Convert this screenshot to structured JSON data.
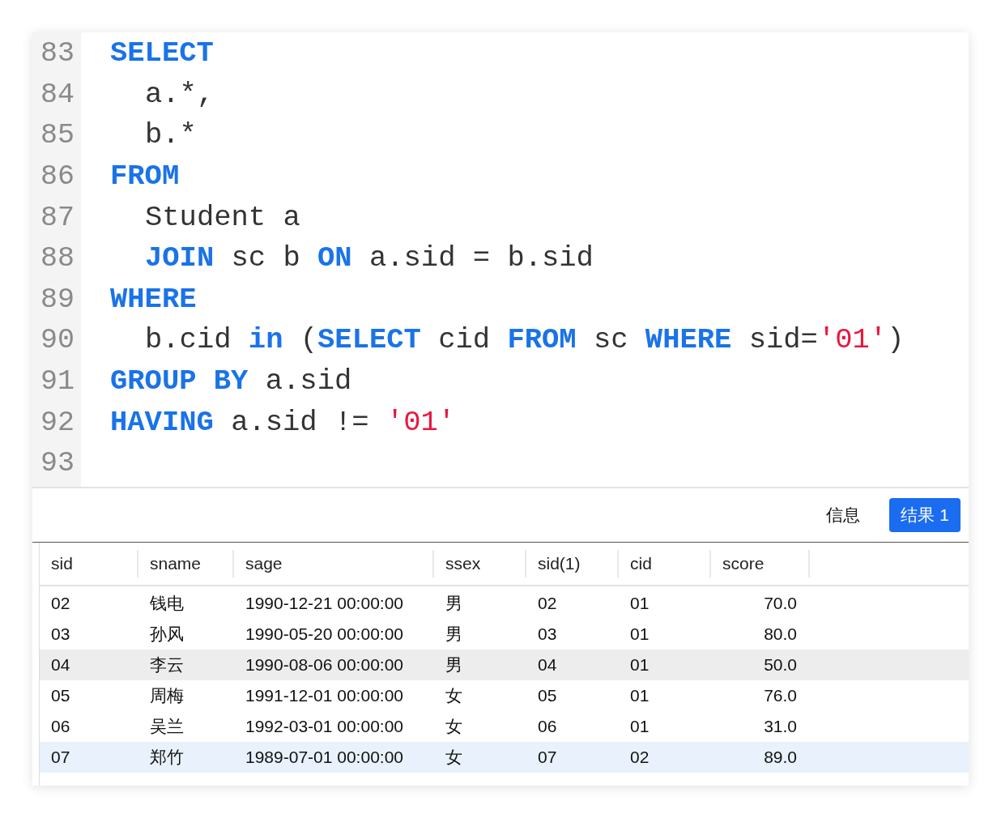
{
  "editor": {
    "lines": [
      {
        "number": "83",
        "indented": false,
        "tokens": [
          {
            "kind": "keyword",
            "text": "SELECT"
          }
        ]
      },
      {
        "number": "84",
        "indented": true,
        "tokens": [
          {
            "kind": "plain",
            "text": "a.*,"
          }
        ]
      },
      {
        "number": "85",
        "indented": true,
        "tokens": [
          {
            "kind": "plain",
            "text": "b.*"
          }
        ]
      },
      {
        "number": "86",
        "indented": false,
        "tokens": [
          {
            "kind": "keyword",
            "text": "FROM"
          }
        ]
      },
      {
        "number": "87",
        "indented": true,
        "tokens": [
          {
            "kind": "plain",
            "text": "Student a"
          }
        ]
      },
      {
        "number": "88",
        "indented": true,
        "tokens": [
          {
            "kind": "keyword",
            "text": "JOIN"
          },
          {
            "kind": "plain",
            "text": " sc b "
          },
          {
            "kind": "keyword",
            "text": "ON"
          },
          {
            "kind": "plain",
            "text": " a.sid = b.sid"
          }
        ]
      },
      {
        "number": "89",
        "indented": false,
        "tokens": [
          {
            "kind": "keyword",
            "text": "WHERE"
          }
        ]
      },
      {
        "number": "90",
        "indented": true,
        "tokens": [
          {
            "kind": "plain",
            "text": "b.cid "
          },
          {
            "kind": "keyword",
            "text": "in"
          },
          {
            "kind": "plain",
            "text": " ("
          },
          {
            "kind": "keyword",
            "text": "SELECT"
          },
          {
            "kind": "plain",
            "text": " cid "
          },
          {
            "kind": "keyword",
            "text": "FROM"
          },
          {
            "kind": "plain",
            "text": " sc "
          },
          {
            "kind": "keyword",
            "text": "WHERE"
          },
          {
            "kind": "plain",
            "text": " sid="
          },
          {
            "kind": "string",
            "text": "'01'"
          },
          {
            "kind": "plain",
            "text": ")"
          }
        ]
      },
      {
        "number": "91",
        "indented": false,
        "tokens": [
          {
            "kind": "keyword",
            "text": "GROUP BY"
          },
          {
            "kind": "plain",
            "text": " a.sid"
          }
        ]
      },
      {
        "number": "92",
        "indented": false,
        "tokens": [
          {
            "kind": "keyword",
            "text": "HAVING"
          },
          {
            "kind": "plain",
            "text": " a.sid != "
          },
          {
            "kind": "string",
            "text": "'01'"
          }
        ]
      },
      {
        "number": "93"
      }
    ]
  },
  "result_tabs": [
    {
      "label": "信息",
      "selected": false
    },
    {
      "label": "结果 1",
      "selected": true
    }
  ],
  "table": {
    "columns": [
      {
        "label": "sid"
      },
      {
        "label": "sname"
      },
      {
        "label": "sage"
      },
      {
        "label": "ssex"
      },
      {
        "label": "sid(1)"
      },
      {
        "label": "cid"
      },
      {
        "label": "score"
      }
    ],
    "rows": [
      {
        "selected": false,
        "hovered": false,
        "cells": [
          "02",
          "钱电",
          "1990-12-21 00:00:00",
          "男",
          "02",
          "01",
          "70.0"
        ]
      },
      {
        "selected": false,
        "hovered": false,
        "cells": [
          "03",
          "孙风",
          "1990-05-20 00:00:00",
          "男",
          "03",
          "01",
          "80.0"
        ]
      },
      {
        "selected": false,
        "hovered": true,
        "cells": [
          "04",
          "李云",
          "1990-08-06 00:00:00",
          "男",
          "04",
          "01",
          "50.0"
        ]
      },
      {
        "selected": false,
        "hovered": false,
        "cells": [
          "05",
          "周梅",
          "1991-12-01 00:00:00",
          "女",
          "05",
          "01",
          "76.0"
        ]
      },
      {
        "selected": false,
        "hovered": false,
        "cells": [
          "06",
          "吴兰",
          "1992-03-01 00:00:00",
          "女",
          "06",
          "01",
          "31.0"
        ]
      },
      {
        "selected": true,
        "hovered": false,
        "cells": [
          "07",
          "郑竹",
          "1989-07-01 00:00:00",
          "女",
          "07",
          "02",
          "89.0"
        ]
      }
    ]
  }
}
